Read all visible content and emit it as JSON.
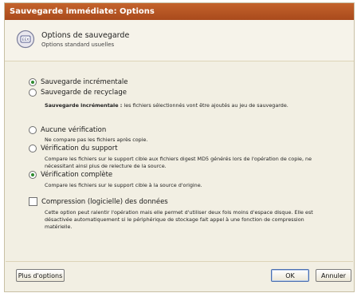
{
  "window": {
    "title": "Sauvegarde immédiate: Options"
  },
  "header": {
    "icon": "backup-options-icon",
    "title": "Options de sauvegarde",
    "subtitle": "Options standard usuelles"
  },
  "backup_mode": {
    "selected": "incremental",
    "options": [
      {
        "label": "Sauvegarde incrémentale"
      },
      {
        "label": "Sauvegarde de recyclage"
      }
    ],
    "description_bold": "Sauvegarde incrémentale :",
    "description_text": "les fichiers sélectionnés vont être ajoutés au jeu de sauvegarde."
  },
  "verification": {
    "selected": "complete",
    "options": [
      {
        "label": "Aucune vérification",
        "desc": "Ne compare pas les fichiers après copie."
      },
      {
        "label": "Vérification du support",
        "desc": "Compare les fichiers sur le support cible aux fichiers digest MD5 générés lors de l'opération de copie, ne nécessitant ainsi plus de relecture de la source."
      },
      {
        "label": "Vérification complète",
        "desc": "Compare les fichiers sur le support cible à la source d'origine."
      }
    ]
  },
  "compression": {
    "checked": false,
    "label": "Compression (logicielle) des données",
    "desc": "Cette option peut ralentir l'opération mais elle permet d'utiliser deux fois moins d'espace disque. Elle est désactivée automatiquement si le périphérique de stockage fait appel à une fonction de compression matérielle."
  },
  "footer": {
    "more_options": "Plus d'options",
    "ok": "OK",
    "cancel": "Annuler"
  },
  "colors": {
    "titlebar": "#b3562a",
    "selected_radio": "#2f8a2f"
  }
}
